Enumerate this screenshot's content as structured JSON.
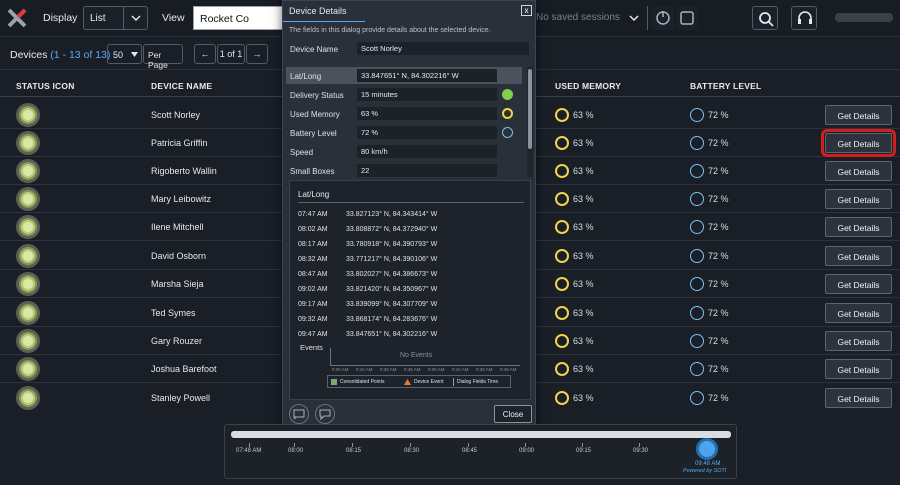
{
  "topbar": {
    "display_label": "Display",
    "display_value": "List",
    "view_label": "View",
    "view_value": "Rocket Co",
    "sessions_placeholder": "No saved sessions"
  },
  "subbar": {
    "devices_label": "Devices",
    "devices_range": "(1 - 13 of 13)",
    "per_page_value": "50",
    "per_page_label": "Per Page",
    "page_info": "1 of 1",
    "prev": "←",
    "next": "→"
  },
  "table": {
    "columns": [
      "STATUS ICON",
      "DEVICE NAME",
      "USED MEMORY",
      "BATTERY LEVEL"
    ],
    "get_details_label": "Get Details",
    "rows": [
      {
        "name": "Scott Norley",
        "memory": "63 %",
        "battery": "72 %"
      },
      {
        "name": "Patricia Griffin",
        "memory": "63 %",
        "battery": "72 %"
      },
      {
        "name": "Rigoberto Wallin",
        "memory": "63 %",
        "battery": "72 %"
      },
      {
        "name": "Mary Leibowitz",
        "memory": "63 %",
        "battery": "72 %"
      },
      {
        "name": "Ilene Mitchell",
        "memory": "63 %",
        "battery": "72 %"
      },
      {
        "name": "David Osborn",
        "memory": "63 %",
        "battery": "72 %"
      },
      {
        "name": "Marsha Sieja",
        "memory": "63 %",
        "battery": "72 %"
      },
      {
        "name": "Ted Symes",
        "memory": "63 %",
        "battery": "72 %"
      },
      {
        "name": "Gary Rouzer",
        "memory": "63 %",
        "battery": "72 %"
      },
      {
        "name": "Joshua Barefoot",
        "memory": "63 %",
        "battery": "72 %"
      },
      {
        "name": "Stanley Powell",
        "memory": "63 %",
        "battery": "72 %"
      }
    ]
  },
  "dialog": {
    "title": "Device Details",
    "close_x": "x",
    "description": "The fields in this dialog provide details about the selected device.",
    "device_name_label": "Device Name",
    "device_name_value": "Scott Norley",
    "fields": [
      {
        "label": "Lat/Long",
        "value": "33.847651° N, 84.302216° W"
      },
      {
        "label": "Delivery Status",
        "value": "15 minutes"
      },
      {
        "label": "Used Memory",
        "value": "63 %"
      },
      {
        "label": "Battery Level",
        "value": "72 %"
      },
      {
        "label": "Speed",
        "value": "80 km/h"
      },
      {
        "label": "Small Boxes",
        "value": "22"
      }
    ],
    "status_colors": {
      "delivery": "#7fd04c",
      "memory": "#f0d54a",
      "battery": "#7cc0f5"
    },
    "latlong_header": "Lat/Long",
    "latlong": [
      {
        "time": "07:47 AM",
        "coord": "33.827123° N, 84.343414° W"
      },
      {
        "time": "08:02 AM",
        "coord": "33.808872° N, 84.372940° W"
      },
      {
        "time": "08:17 AM",
        "coord": "33.780918° N, 84.390793° W"
      },
      {
        "time": "08:32 AM",
        "coord": "33.771217° N, 84.390106° W"
      },
      {
        "time": "08:47 AM",
        "coord": "33.802027° N, 84.386673° W"
      },
      {
        "time": "09:02 AM",
        "coord": "33.821420° N, 84.350967° W"
      },
      {
        "time": "09:17 AM",
        "coord": "33.839099° N, 84.307709° W"
      },
      {
        "time": "09:32 AM",
        "coord": "33.868174° N, 84.283676° W"
      },
      {
        "time": "09:47 AM",
        "coord": "33.847651° N, 84.302216° W"
      }
    ],
    "events_label": "Events",
    "no_events": "No Events",
    "event_ticks": [
      "8:00 AM",
      "8:15 AM",
      "8:30 AM",
      "8:45 AM",
      "9:00 AM",
      "9:15 AM",
      "9:30 AM",
      "9:45 AM"
    ],
    "legend": [
      "Consolidated Points",
      "Device Event",
      "Dialog Fields Time"
    ],
    "close_label": "Close"
  },
  "timeline": {
    "ticks": [
      "07:48 AM",
      "08:00",
      "08:15",
      "08:30",
      "08:45",
      "09:00",
      "09:15",
      "09:30"
    ],
    "current_time": "09:48 AM",
    "powered_by": "Powered by SOTI"
  },
  "colors": {
    "accent": "#55aaf5",
    "highlight": "#d21e1e"
  }
}
